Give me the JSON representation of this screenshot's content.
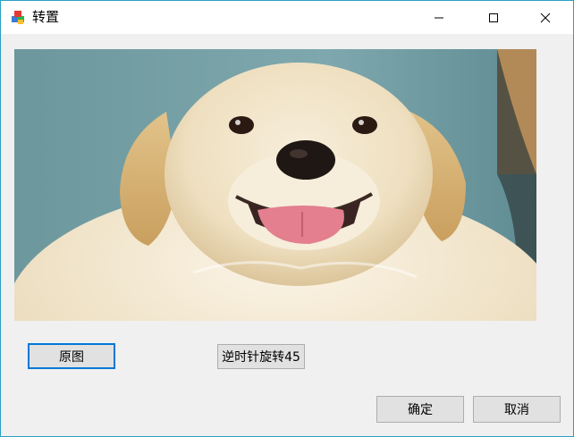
{
  "window": {
    "title": "转置",
    "controls": [
      "minimize-icon",
      "maximize-icon",
      "close-icon"
    ]
  },
  "image": {
    "subject": "puppy-photo"
  },
  "buttons": {
    "original": "原图",
    "rotate": "逆时针旋转45",
    "ok": "确定",
    "cancel": "取消"
  },
  "colors": {
    "window_border": "#2b9fc4",
    "focus_border": "#0078d7",
    "button_face": "#e1e1e1",
    "dialog_background": "#f0f0f0"
  }
}
